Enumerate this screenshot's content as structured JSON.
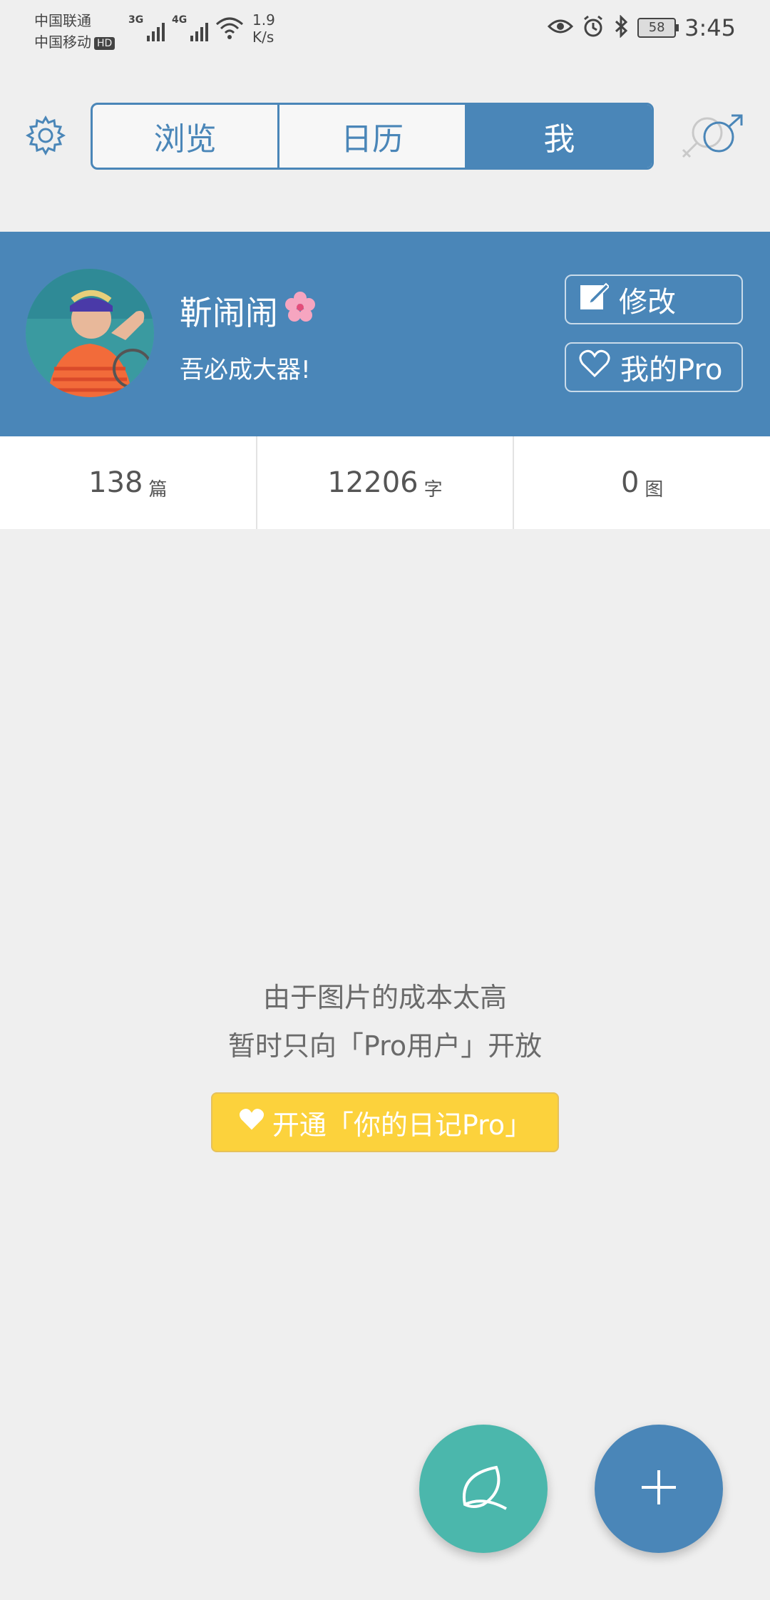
{
  "status_bar": {
    "carrier1": "中国联通",
    "carrier2": "中国移动",
    "hd": "HD",
    "net1": "3G",
    "net2": "4G",
    "speed_value": "1.9",
    "speed_unit": "K/s",
    "battery": "58",
    "time": "3:45"
  },
  "header": {
    "tabs": [
      {
        "label": "浏览"
      },
      {
        "label": "日历"
      },
      {
        "label": "我"
      }
    ]
  },
  "profile": {
    "name": "靳闹闹",
    "bio": "吾必成大器!",
    "edit_label": "修改",
    "pro_label": "我的Pro"
  },
  "stats": [
    {
      "value": "138",
      "unit": "篇"
    },
    {
      "value": "12206",
      "unit": "字"
    },
    {
      "value": "0",
      "unit": "图"
    }
  ],
  "notice": {
    "line1": "由于图片的成本太高",
    "line2": "暂时只向「Pro用户」开放",
    "button": "开通「你的日记Pro」"
  },
  "colors": {
    "primary": "#4a86b8",
    "teal": "#4bb7ac",
    "yellow": "#fcd23c",
    "background": "#efefef"
  }
}
